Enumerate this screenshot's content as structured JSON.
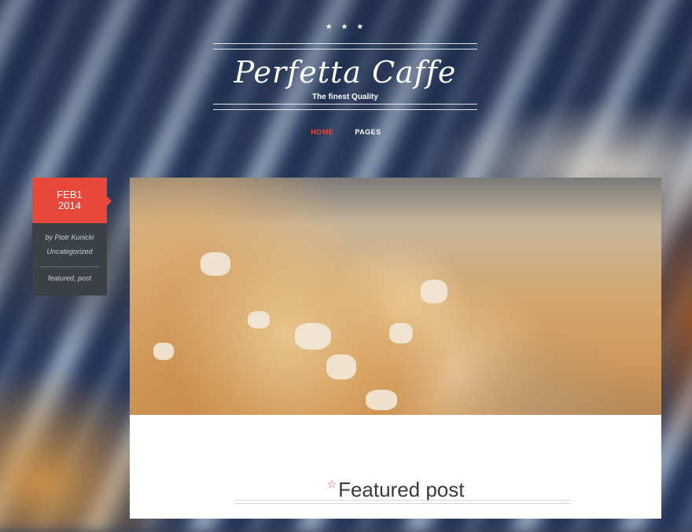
{
  "header": {
    "stars": "★ ★ ★",
    "site_title": "Perfetta Caffe",
    "tagline": "The finest Quality"
  },
  "nav": {
    "items": [
      {
        "label": "HOME",
        "active": true
      },
      {
        "label": "PAGES",
        "active": false
      }
    ]
  },
  "post": {
    "date_line1": "FEB1",
    "date_line2": "2014",
    "author": "by Piotr Kunicki",
    "category": "Uncategorized",
    "tags": "featured, post",
    "title_icon": "star-outline-icon",
    "title": "Featured post"
  },
  "colors": {
    "accent": "#e8473b",
    "meta_bg": "#3c4146"
  }
}
